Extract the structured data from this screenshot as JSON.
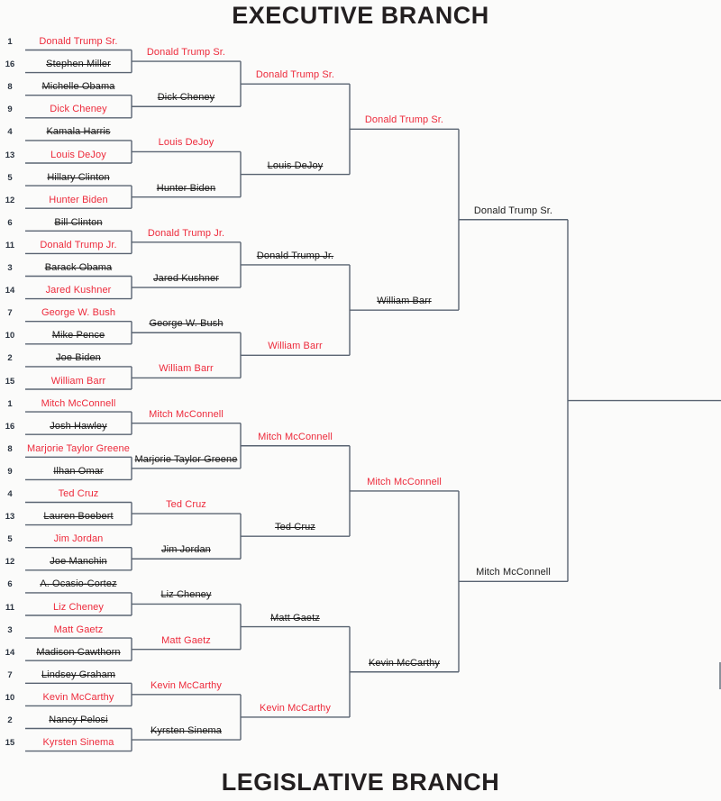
{
  "titles": {
    "top": "EXECUTIVE BRANCH",
    "bottom": "LEGISLATIVE BRANCH"
  },
  "colors": {
    "winner": "#ed2a3b",
    "eliminated": "#1b1b1b",
    "line": "#5a6472",
    "background": "#fbfbfa"
  },
  "legend": {
    "winner_style": "red text",
    "eliminated_style": "black strikethrough text"
  },
  "seeds": [
    1,
    16,
    8,
    9,
    4,
    13,
    5,
    12,
    6,
    11,
    3,
    14,
    7,
    10,
    2,
    15,
    1,
    16,
    8,
    9,
    4,
    13,
    5,
    12,
    6,
    11,
    3,
    14,
    7,
    10,
    2,
    15
  ],
  "round1": [
    {
      "seed": "1",
      "name": "Donald Trump Sr.",
      "state": "win"
    },
    {
      "seed": "16",
      "name": "Stephen Miller",
      "state": "out"
    },
    {
      "seed": "8",
      "name": "Michelle Obama",
      "state": "out"
    },
    {
      "seed": "9",
      "name": "Dick Cheney",
      "state": "win"
    },
    {
      "seed": "4",
      "name": "Kamala Harris",
      "state": "out"
    },
    {
      "seed": "13",
      "name": "Louis DeJoy",
      "state": "win"
    },
    {
      "seed": "5",
      "name": "Hillary Clinton",
      "state": "out"
    },
    {
      "seed": "12",
      "name": "Hunter Biden",
      "state": "win"
    },
    {
      "seed": "6",
      "name": "Bill Clinton",
      "state": "out"
    },
    {
      "seed": "11",
      "name": "Donald Trump Jr.",
      "state": "win"
    },
    {
      "seed": "3",
      "name": "Barack Obama",
      "state": "out"
    },
    {
      "seed": "14",
      "name": "Jared Kushner",
      "state": "win"
    },
    {
      "seed": "7",
      "name": "George W. Bush",
      "state": "win"
    },
    {
      "seed": "10",
      "name": "Mike Pence",
      "state": "out"
    },
    {
      "seed": "2",
      "name": "Joe Biden",
      "state": "out"
    },
    {
      "seed": "15",
      "name": "William Barr",
      "state": "win"
    },
    {
      "seed": "1",
      "name": "Mitch McConnell",
      "state": "win"
    },
    {
      "seed": "16",
      "name": "Josh Hawley",
      "state": "out"
    },
    {
      "seed": "8",
      "name": "Marjorie Taylor Greene",
      "state": "win"
    },
    {
      "seed": "9",
      "name": "Ilhan Omar",
      "state": "out"
    },
    {
      "seed": "4",
      "name": "Ted Cruz",
      "state": "win"
    },
    {
      "seed": "13",
      "name": "Lauren Boebert",
      "state": "out"
    },
    {
      "seed": "5",
      "name": "Jim Jordan",
      "state": "win"
    },
    {
      "seed": "12",
      "name": "Joe Manchin",
      "state": "out"
    },
    {
      "seed": "6",
      "name": "A. Ocasio-Cortez",
      "state": "out"
    },
    {
      "seed": "11",
      "name": "Liz Cheney",
      "state": "win"
    },
    {
      "seed": "3",
      "name": "Matt Gaetz",
      "state": "win"
    },
    {
      "seed": "14",
      "name": "Madison Cawthorn",
      "state": "out"
    },
    {
      "seed": "7",
      "name": "Lindsey Graham",
      "state": "out"
    },
    {
      "seed": "10",
      "name": "Kevin McCarthy",
      "state": "win"
    },
    {
      "seed": "2",
      "name": "Nancy Pelosi",
      "state": "out"
    },
    {
      "seed": "15",
      "name": "Kyrsten Sinema",
      "state": "win"
    }
  ],
  "round2": [
    {
      "name": "Donald Trump Sr.",
      "state": "win"
    },
    {
      "name": "Dick Cheney",
      "state": "out"
    },
    {
      "name": "Louis DeJoy",
      "state": "win"
    },
    {
      "name": "Hunter Biden",
      "state": "out"
    },
    {
      "name": "Donald Trump Jr.",
      "state": "win"
    },
    {
      "name": "Jared Kushner",
      "state": "out"
    },
    {
      "name": "George W. Bush",
      "state": "out"
    },
    {
      "name": "William Barr",
      "state": "win"
    },
    {
      "name": "Mitch McConnell",
      "state": "win"
    },
    {
      "name": "Marjorie Taylor Greene",
      "state": "out"
    },
    {
      "name": "Ted Cruz",
      "state": "win"
    },
    {
      "name": "Jim Jordan",
      "state": "out"
    },
    {
      "name": "Liz Cheney",
      "state": "out"
    },
    {
      "name": "Matt Gaetz",
      "state": "win"
    },
    {
      "name": "Kevin McCarthy",
      "state": "win"
    },
    {
      "name": "Kyrsten Sinema",
      "state": "out"
    }
  ],
  "round3": [
    {
      "name": "Donald Trump Sr.",
      "state": "win"
    },
    {
      "name": "Louis DeJoy",
      "state": "out"
    },
    {
      "name": "Donald Trump Jr.",
      "state": "out"
    },
    {
      "name": "William Barr",
      "state": "win"
    },
    {
      "name": "Mitch McConnell",
      "state": "win"
    },
    {
      "name": "Ted Cruz",
      "state": "out"
    },
    {
      "name": "Matt Gaetz",
      "state": "out"
    },
    {
      "name": "Kevin McCarthy",
      "state": "win"
    }
  ],
  "round4": [
    {
      "name": "Donald Trump Sr.",
      "state": "win"
    },
    {
      "name": "William Barr",
      "state": "out"
    },
    {
      "name": "Mitch McConnell",
      "state": "win"
    },
    {
      "name": "Kevin McCarthy",
      "state": "out"
    }
  ],
  "round5": [
    {
      "name": "Donald Trump Sr.",
      "state": "neutral"
    },
    {
      "name": "Mitch McConnell",
      "state": "neutral"
    }
  ]
}
